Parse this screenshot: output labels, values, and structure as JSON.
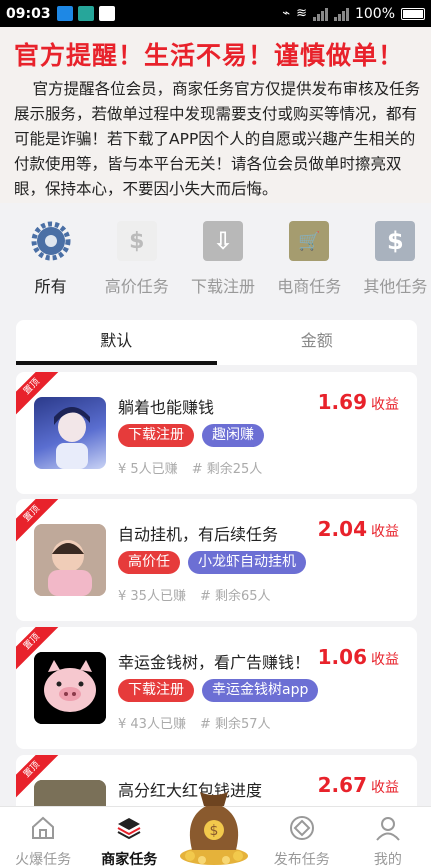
{
  "status": {
    "time": "09:03",
    "battery": "100%"
  },
  "notice": {
    "title": "官方提醒！生活不易！谨慎做单！",
    "body": "官方提醒各位会员，商家任务官方仅提供发布审核及任务展示服务，若做单过程中发现需要支付或购买等情况，都有可能是诈骗！若下载了APP因个人的自愿或兴趣产生相关的付款使用等，皆与本平台无关！请各位会员做单时擦亮双眼，保持本心，不要因小失大而后悔。"
  },
  "categories": [
    {
      "label": "所有",
      "icon": "gear-icon"
    },
    {
      "label": "高价任务",
      "icon": "money-hand-icon"
    },
    {
      "label": "下载注册",
      "icon": "download-icon"
    },
    {
      "label": "电商任务",
      "icon": "cart-icon"
    },
    {
      "label": "其他任务",
      "icon": "dollar-icon"
    }
  ],
  "tabs": [
    "默认",
    "金额"
  ],
  "ribbon": "置顶",
  "price_unit": "收益",
  "tasks": [
    {
      "title": "躺着也能赚钱",
      "price": "1.69",
      "tags": [
        "下载注册",
        "趣闲赚"
      ],
      "done": "¥ 5人已赚",
      "left": "# 剩余25人"
    },
    {
      "title": "自动挂机，有后续任务",
      "price": "2.04",
      "tags": [
        "高价任",
        "小龙虾自动挂机"
      ],
      "done": "¥ 35人已赚",
      "left": "# 剩余65人"
    },
    {
      "title": "幸运金钱树，看广告赚钱！",
      "price": "1.06",
      "tags": [
        "下载注册",
        "幸运金钱树app"
      ],
      "done": "¥ 43人已赚",
      "left": "# 剩余57人"
    },
    {
      "title": "高分红大红包钱进度",
      "price": "2.67",
      "tags": [],
      "done": "",
      "left": ""
    }
  ],
  "nav": [
    {
      "label": "火爆任务",
      "icon": "home-icon"
    },
    {
      "label": "商家任务",
      "icon": "layers-icon"
    },
    {
      "label": "",
      "icon": "money-bag-icon"
    },
    {
      "label": "发布任务",
      "icon": "publish-icon"
    },
    {
      "label": "我的",
      "icon": "user-icon"
    }
  ],
  "colors": {
    "accent": "#e8222b",
    "tag_red": "#e63b3b",
    "tag_purple": "#6c6fd4"
  }
}
